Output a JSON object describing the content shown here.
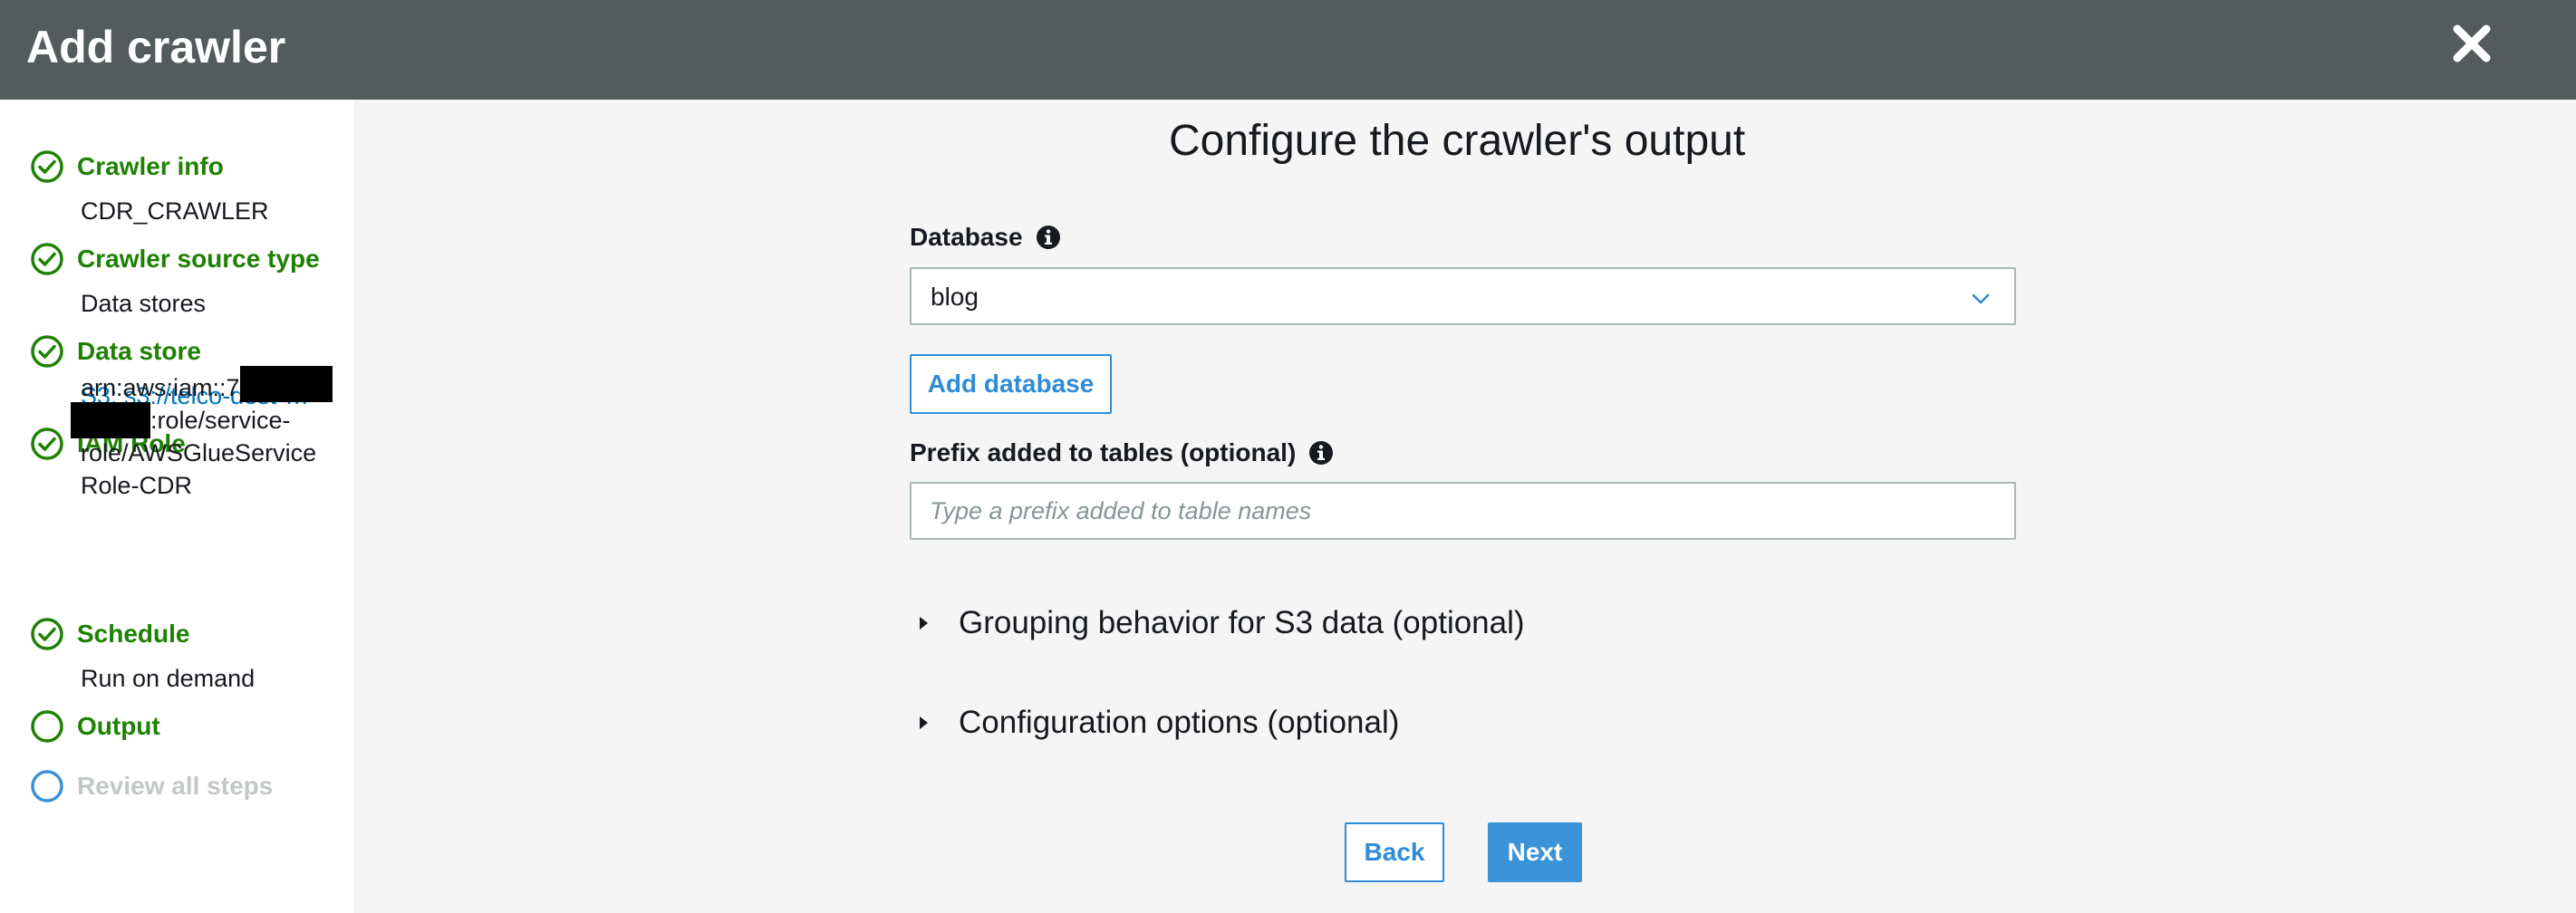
{
  "header": {
    "title": "Add crawler"
  },
  "sidebar": {
    "steps": [
      {
        "label": "Crawler info",
        "value": "CDR_CRAWLER"
      },
      {
        "label": "Crawler source type",
        "value": "Data stores"
      },
      {
        "label": "Data store",
        "value": "S3: s3://telco-dest-…"
      },
      {
        "label": "IAM Role",
        "value_lines": [
          "arn:aws:iam::7",
          ":role/service-",
          "role/AWSGlueService",
          "Role-CDR"
        ]
      },
      {
        "label": "Schedule",
        "value": "Run on demand"
      },
      {
        "label": "Output"
      },
      {
        "label": "Review all steps"
      }
    ]
  },
  "main": {
    "title": "Configure the crawler's output",
    "database": {
      "label": "Database",
      "selected": "blog"
    },
    "add_database_label": "Add database",
    "prefix": {
      "label": "Prefix added to tables (optional)",
      "value": "",
      "placeholder": "Type a prefix added to table names"
    },
    "expanders": [
      {
        "label": "Grouping behavior for S3 data (optional)"
      },
      {
        "label": "Configuration options (optional)"
      }
    ],
    "back_label": "Back",
    "next_label": "Next"
  },
  "colors": {
    "header_bg": "#545b5d",
    "complete_green": "#1d8102",
    "pending_gray": "#c3c7c8",
    "link_blue": "#0073bb",
    "primary_blue": "#3a93d6"
  },
  "icons": {
    "close": "close-icon",
    "step_complete": "check-circle-icon",
    "step_current": "circle-icon",
    "info": "info-icon",
    "dropdown": "chevron-down-icon",
    "expander": "caret-right-icon"
  }
}
